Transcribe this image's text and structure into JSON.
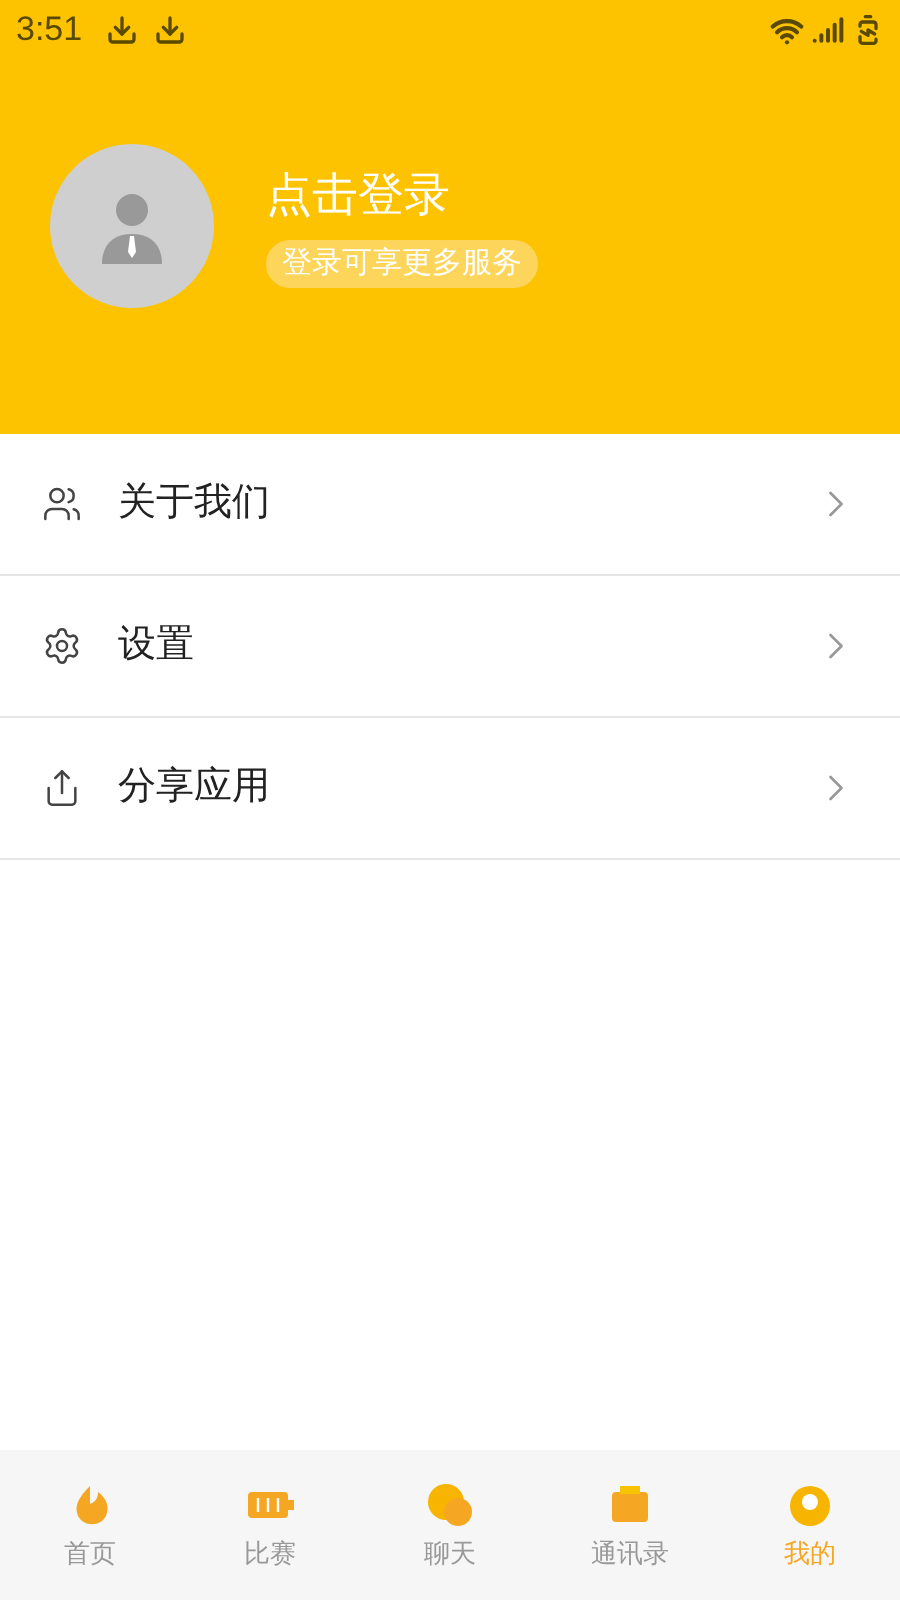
{
  "status_bar": {
    "time": "3:51"
  },
  "profile": {
    "title": "点击登录",
    "subtitle": "登录可享更多服务"
  },
  "menu": [
    {
      "kind": "people",
      "label": "关于我们"
    },
    {
      "kind": "settings",
      "label": "设置"
    },
    {
      "kind": "share",
      "label": "分享应用"
    }
  ],
  "tabs": [
    {
      "label": "首页",
      "selected": false
    },
    {
      "label": "比赛",
      "selected": false
    },
    {
      "label": "聊天",
      "selected": false
    },
    {
      "label": "通讯录",
      "selected": false
    },
    {
      "label": "我的",
      "selected": true
    }
  ]
}
